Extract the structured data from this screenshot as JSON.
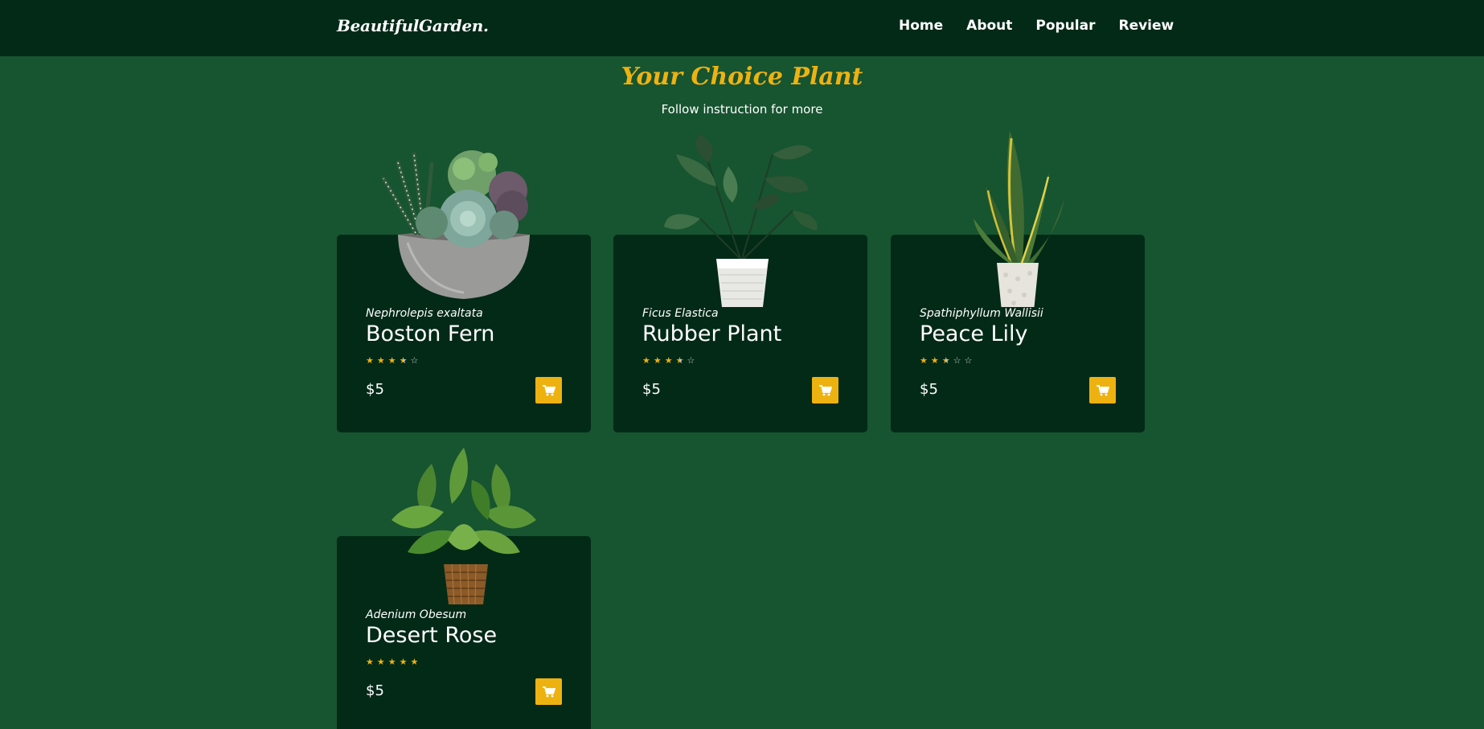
{
  "header": {
    "logo": "BeautifulGarden.",
    "nav": [
      "Home",
      "About",
      "Popular",
      "Review"
    ]
  },
  "section": {
    "title": "Your Choice Plant",
    "subtitle": "Follow instruction for more"
  },
  "colors": {
    "accent": "#eeb210",
    "background": "#175430",
    "card": "#032a17",
    "header": "#032a17"
  },
  "products": [
    {
      "latin": "Nephrolepis exaltata",
      "name": "Boston Fern",
      "rating": 3.5,
      "price": "$5",
      "image": "succulent-bowl-icon"
    },
    {
      "latin": "Ficus Elastica",
      "name": "Rubber Plant",
      "rating": 3.5,
      "price": "$5",
      "image": "rubber-plant-icon"
    },
    {
      "latin": "Spathiphyllum Wallisii",
      "name": "Peace Lily",
      "rating": 2.5,
      "price": "$5",
      "image": "snake-plant-icon"
    },
    {
      "latin": "Adenium Obesum",
      "name": "Desert Rose",
      "rating": 5,
      "price": "$5",
      "image": "leafy-plant-icon"
    }
  ],
  "icons": {
    "cart": "cart-icon",
    "star": "star-icon"
  }
}
